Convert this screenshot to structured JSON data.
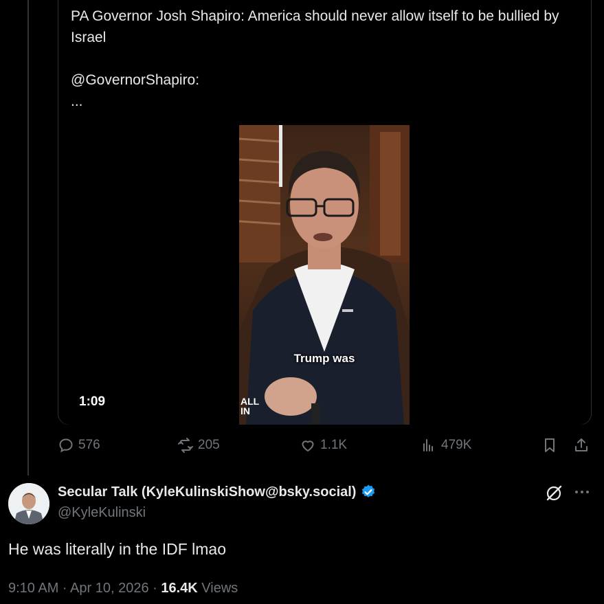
{
  "quoted_tweet": {
    "text": "PA Governor Josh Shapiro: America should never allow itself to be bullied by Israel\n\n@GovernorShapiro:\n...",
    "video": {
      "duration": "1:09",
      "caption": "Trump was",
      "watermark_line1": "ALL",
      "watermark_line2": "IN"
    }
  },
  "actions": {
    "replies": "576",
    "reposts": "205",
    "likes": "1.1K",
    "views": "479K"
  },
  "reply_tweet": {
    "display_name": "Secular Talk (KyleKulinskiShow@bsky.social)",
    "handle": "@KyleKulinski",
    "text": "He was literally in the IDF lmao",
    "time": "9:10 AM · Apr 10, 2026 · ",
    "views_count": "16.4K",
    "views_label": " Views"
  },
  "colors": {
    "background": "#000000",
    "text": "#e7e9ea",
    "muted": "#71767b",
    "verified": "#1d9bf0"
  }
}
